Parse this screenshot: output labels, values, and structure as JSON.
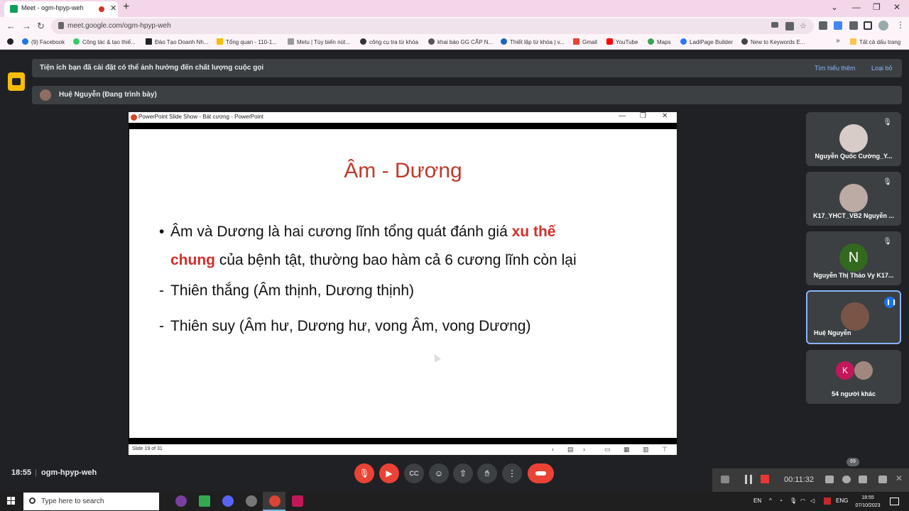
{
  "browser": {
    "tab_title": "Meet - ogm-hpyp-weh",
    "url": "meet.google.com/ogm-hpyp-weh",
    "bookmarks": [
      "(9) Facebook",
      "Công tác & tạo thiế...",
      "Đào Tạo Doanh Nh...",
      "Tổng quan - 110-1...",
      "Metu | Tùy biến nút...",
      "công cụ tra từ khóa",
      "khai báo GG CẤP N...",
      "Thiết lập từ khóa | v...",
      "Gmail",
      "YouTube",
      "Maps",
      "LadiPage Builder",
      "New to Keywords E..."
    ],
    "all_bookmarks": "Tất cả dấu trang",
    "overflow": "»"
  },
  "meet": {
    "notice": "Tiện ích bạn đã cài đặt có thể ảnh hưởng đến chất lượng cuộc gọi",
    "learn_more": "Tìm hiểu thêm",
    "dismiss": "Loại bỏ",
    "presenter": "Huệ Nguyễn (Đang trình bày)",
    "time": "18:55",
    "separator": "|",
    "meeting_code": "ogm-hpyp-weh",
    "participant_count_badge": "69",
    "participants": [
      {
        "name": "Nguyễn Quốc Cường_Y...",
        "muted": true
      },
      {
        "name": "K17_YHCT_VB2 Nguyễn ...",
        "muted": true
      },
      {
        "name": "Nguyễn Thị Thảo Vy K17...",
        "initial": "N",
        "muted": true
      },
      {
        "name": "Huệ Nguyễn",
        "speaking": true
      }
    ],
    "others": {
      "initial": "K",
      "label": "54 người khác"
    }
  },
  "powerpoint": {
    "window_title": "PowerPoint Slide Show  -  Bát cương - PowerPoint",
    "slide": {
      "title": "Âm - Dương",
      "bullet_intro": "Âm và Dương là hai cương lĩnh tổng quát đánh giá ",
      "bullet_hl1": "xu thế",
      "bullet_hl2": "chung",
      "bullet_rest": " của bệnh tật, thường bao hàm cả 6 cương lĩnh còn lại",
      "dash1": "Thiên thắng (Âm thịnh, Dương thịnh)",
      "dash2": "Thiên suy (Âm hư, Dương hư, vong Âm, vong Dương)"
    },
    "status": "Slide 19 of 31"
  },
  "recorder": {
    "elapsed": "00:11:32"
  },
  "taskbar": {
    "search_placeholder": "Type here to search",
    "lang": "EN",
    "keyboard": "ENG",
    "clock_time": "18:55",
    "clock_date": "07/10/2023"
  }
}
